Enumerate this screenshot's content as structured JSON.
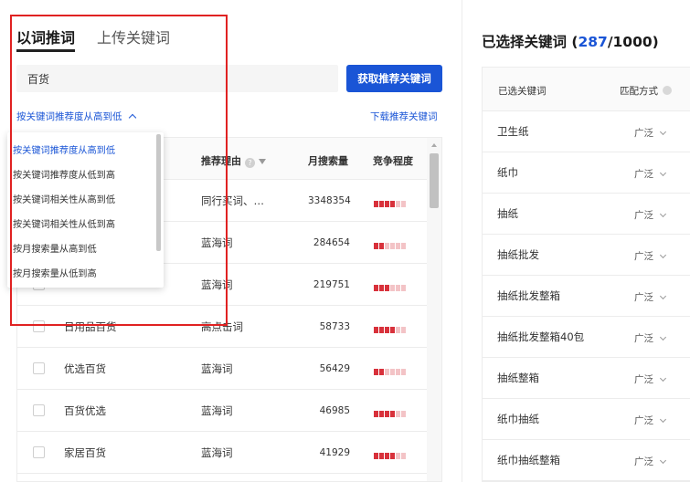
{
  "tabs": {
    "active": "以词推词",
    "inactive": "上传关键词"
  },
  "search": {
    "value": "百货"
  },
  "get_button": "获取推荐关键词",
  "sort_toggle": "按关键词推荐度从高到低",
  "download_link": "下载推荐关键词",
  "sort_options": [
    "按关键词推荐度从高到低",
    "按关键词推荐度从低到高",
    "按关键词相关性从高到低",
    "按关键词相关性从低到高",
    "按月搜索量从高到低",
    "按月搜索量从低到高"
  ],
  "table": {
    "headers": {
      "reason": "推荐理由",
      "volume": "月搜索量",
      "competition": "竞争程度"
    },
    "rows": [
      {
        "keyword": "",
        "reason": "同行买词、…",
        "volume": "3348354",
        "competition": 4
      },
      {
        "keyword": "",
        "reason": "蓝海词",
        "volume": "284654",
        "competition": 2
      },
      {
        "keyword": "",
        "reason": "蓝海词",
        "volume": "219751",
        "competition": 3
      },
      {
        "keyword": "日用品百货",
        "reason": "高点击词",
        "volume": "58733",
        "competition": 4
      },
      {
        "keyword": "优选百货",
        "reason": "蓝海词",
        "volume": "56429",
        "competition": 2
      },
      {
        "keyword": "百货优选",
        "reason": "蓝海词",
        "volume": "46985",
        "competition": 4
      },
      {
        "keyword": "家居百货",
        "reason": "蓝海词",
        "volume": "41929",
        "competition": 4
      }
    ]
  },
  "colors": {
    "accent": "#1a55d6",
    "highlight": "#e02222",
    "bar_on": "#d8313b",
    "bar_off": "#f3c3c6"
  },
  "selected": {
    "title_prefix": "已选择关键词 (",
    "count": "287",
    "total": "/1000)",
    "headers": {
      "keyword": "已选关键词",
      "match": "匹配方式"
    },
    "rows": [
      {
        "keyword": "卫生纸",
        "match": "广泛"
      },
      {
        "keyword": "纸巾",
        "match": "广泛"
      },
      {
        "keyword": "抽纸",
        "match": "广泛"
      },
      {
        "keyword": "抽纸批发",
        "match": "广泛"
      },
      {
        "keyword": "抽纸批发整箱",
        "match": "广泛"
      },
      {
        "keyword": "抽纸批发整箱40包",
        "match": "广泛"
      },
      {
        "keyword": "抽纸整箱",
        "match": "广泛"
      },
      {
        "keyword": "纸巾抽纸",
        "match": "广泛"
      },
      {
        "keyword": "纸巾抽纸整箱",
        "match": "广泛"
      }
    ]
  }
}
